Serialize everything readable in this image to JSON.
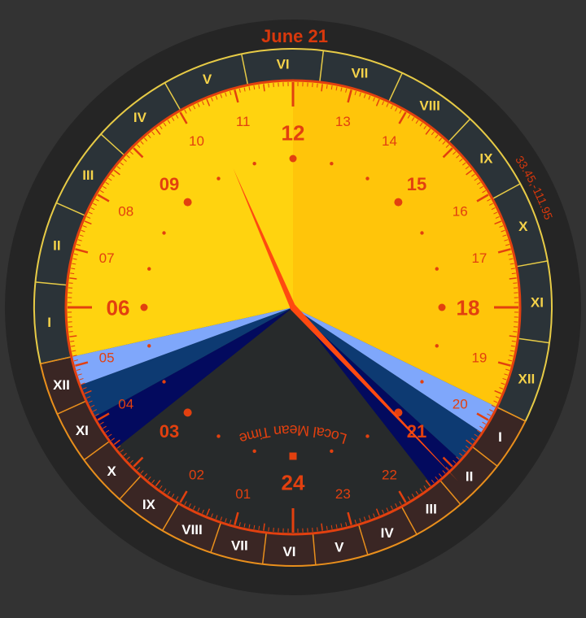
{
  "date_label": "June 21",
  "coordinates": "33.45,-111.95",
  "time_mode_label": "Local Mean Time",
  "hour_numerals": [
    "24",
    "01",
    "02",
    "03",
    "04",
    "05",
    "06",
    "07",
    "08",
    "09",
    "10",
    "11",
    "12",
    "13",
    "14",
    "15",
    "16",
    "17",
    "18",
    "19",
    "20",
    "21",
    "22",
    "23"
  ],
  "major_hours": [
    "06",
    "12",
    "18",
    "24"
  ],
  "day_ring": {
    "start_hour": 5.16,
    "end_hour": 19.74,
    "labels": [
      "I",
      "II",
      "III",
      "IV",
      "V",
      "VI",
      "VII",
      "VIII",
      "IX",
      "X",
      "XI",
      "XII"
    ]
  },
  "night_ring": {
    "start_hour": 19.74,
    "end_hour": 29.16,
    "labels": [
      "I",
      "II",
      "III",
      "IV",
      "V",
      "VI",
      "VII",
      "VIII",
      "IX",
      "X",
      "XI",
      "XII"
    ]
  },
  "twilight": {
    "morning": {
      "sunrise_hour": 5.16,
      "civil_dawn_hour": 4.66,
      "nautical_dawn_hour": 4.07,
      "astronomical_dawn_hour": 3.43
    },
    "evening": {
      "sunset_hour": 19.74,
      "civil_dusk_hour": 20.24,
      "nautical_dusk_hour": 20.83,
      "astronomical_dusk_hour": 21.47
    }
  },
  "hands": {
    "long_hand_hour": 10.45,
    "short_hand_hour": 21.1
  },
  "colors": {
    "background": "#333333",
    "bezel": "#252525",
    "day_ring_fill": "#2b3338",
    "night_ring_fill": "#3a2624",
    "day_ring_border": "#e7cb46",
    "night_ring_border": "#e98f1c",
    "day_ring_text": "#f4d24a",
    "night_ring_text": "#ffffff",
    "daylight_left": "#ffd30f",
    "daylight_right": "#ffc50a",
    "civil_twilight": "#7fa7fb",
    "nautical_twilight": "#0d3a72",
    "astronomical_twilight": "#030a5e",
    "night": "#272a2b",
    "accent": "#e2400f",
    "hand": "#ff4a10",
    "date_text": "#d8380c"
  }
}
